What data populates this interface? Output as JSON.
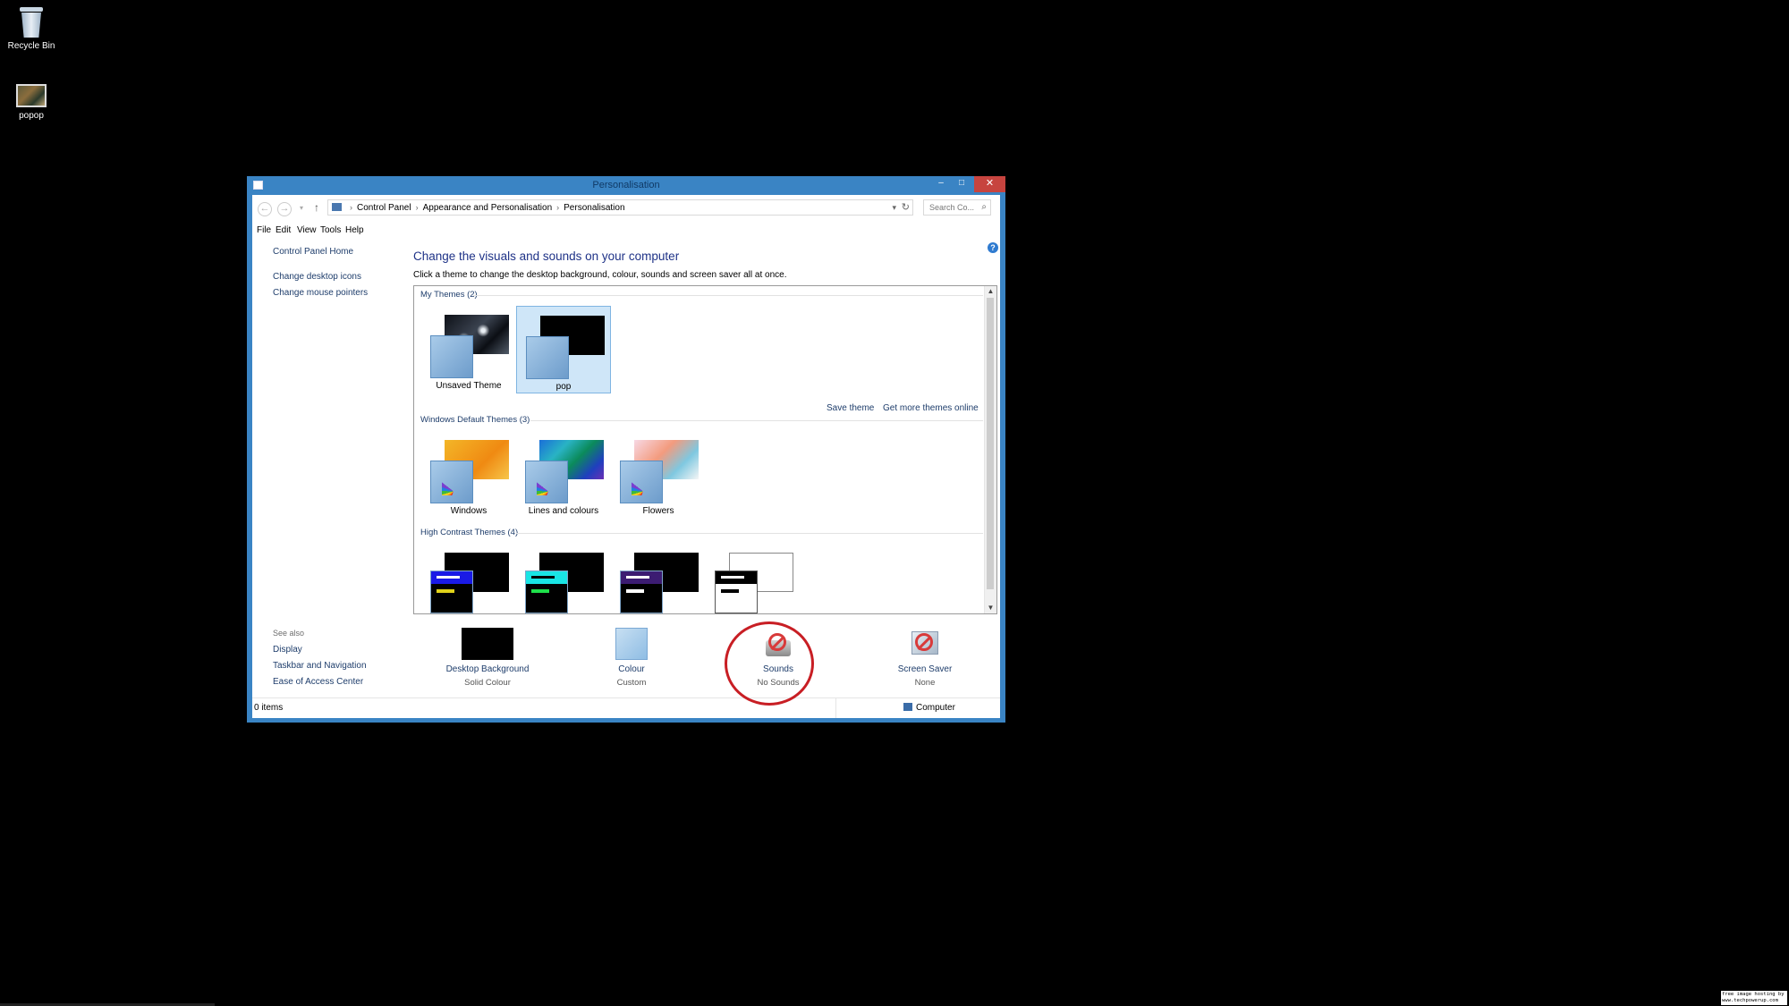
{
  "desktop": {
    "icons": [
      {
        "label": "Recycle Bin",
        "icon": "recycle-bin-icon"
      },
      {
        "label": "popop",
        "icon": "image-file-icon"
      }
    ],
    "watermark": "free image hosting by www.techpowerup.com"
  },
  "window": {
    "title": "Personalisation",
    "controls": {
      "minimize": "–",
      "maximize": "□",
      "close": "✕"
    },
    "address": {
      "crumbs": [
        "Control Panel",
        "Appearance and Personalisation",
        "Personalisation"
      ],
      "search_placeholder": "Search Co..."
    },
    "menu": [
      "File",
      "Edit",
      "View",
      "Tools",
      "Help"
    ],
    "left_nav": {
      "home": "Control Panel Home",
      "links": [
        "Change desktop icons",
        "Change mouse pointers"
      ],
      "see_also_title": "See also",
      "see_also": [
        "Display",
        "Taskbar and Navigation",
        "Ease of Access Center"
      ]
    },
    "main": {
      "heading": "Change the visuals and sounds on your computer",
      "subheading": "Click a theme to change the desktop background, colour, sounds and screen saver all at once.",
      "groups": {
        "my_themes": "My Themes (2)",
        "default_themes": "Windows Default Themes (3)",
        "high_contrast": "High Contrast Themes (4)"
      },
      "my_themes": [
        {
          "label": "Unsaved Theme",
          "selected": false
        },
        {
          "label": "pop",
          "selected": true
        }
      ],
      "actions": {
        "save": "Save theme",
        "more": "Get more themes online"
      },
      "default_themes": [
        {
          "label": "Windows"
        },
        {
          "label": "Lines and colours"
        },
        {
          "label": "Flowers"
        }
      ]
    },
    "bottom": [
      {
        "title": "Desktop Background",
        "sub": "Solid Colour"
      },
      {
        "title": "Colour",
        "sub": "Custom"
      },
      {
        "title": "Sounds",
        "sub": "No Sounds"
      },
      {
        "title": "Screen Saver",
        "sub": "None"
      }
    ],
    "status": {
      "items": "0 items",
      "location": "Computer"
    },
    "colors": {
      "titlebar": "#3a84c4",
      "close": "#c7443f",
      "link": "#1e3d6b",
      "highlight_circle": "#c81e24"
    }
  }
}
